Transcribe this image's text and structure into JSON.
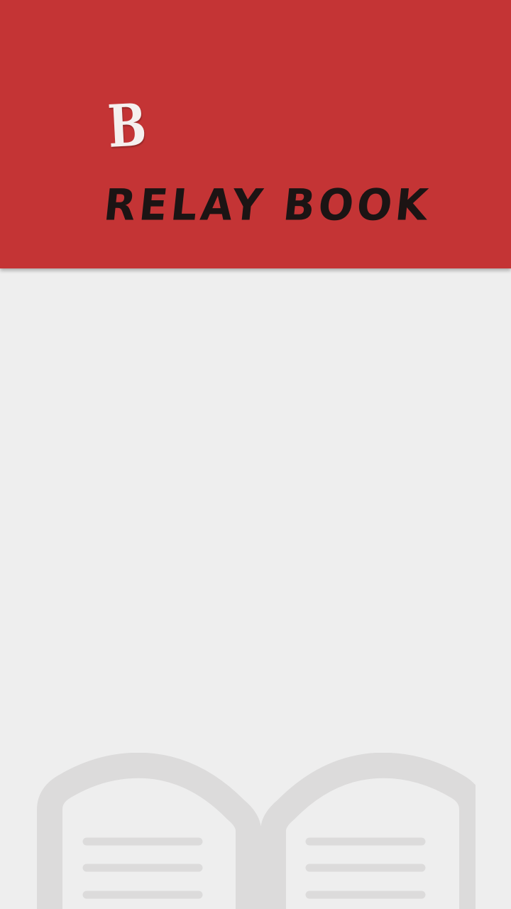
{
  "header": {
    "logo_letter": "B",
    "app_title": "RELAY BOOK",
    "background_color": "#c43435",
    "title_color": "#1c1414",
    "logo_letter_color": "#f5f0ef"
  },
  "content": {
    "background_color": "#eeeeee"
  },
  "illustration": {
    "icon": "open-book-icon",
    "color": "#dcdbdb"
  }
}
